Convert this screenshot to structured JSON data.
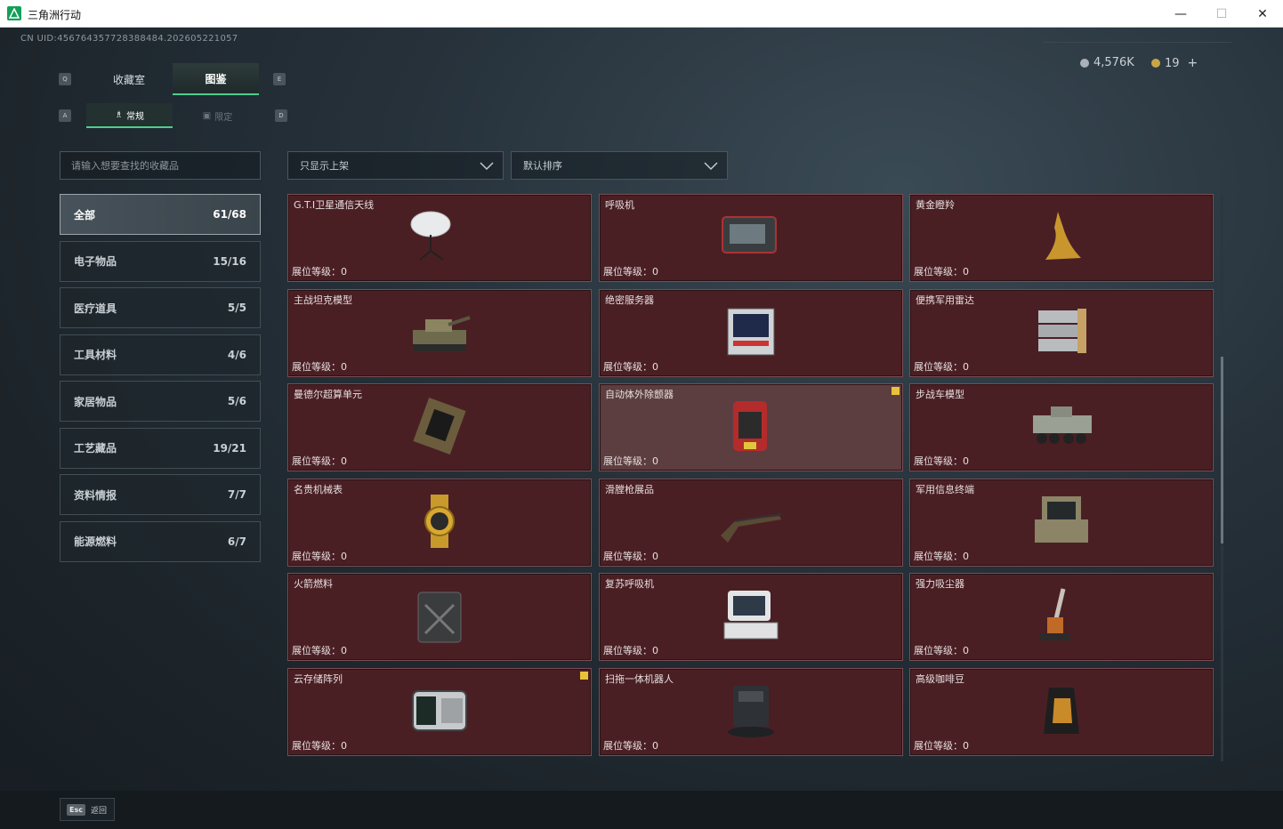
{
  "window": {
    "title": "三角洲行动",
    "min": "—",
    "max": "☐",
    "close": "✕"
  },
  "uid": "CN UID:456764357728388484.202605221057",
  "currency": {
    "silver": "4,576K",
    "gold": "19",
    "add": "+"
  },
  "keys": {
    "q": "Q",
    "e": "E",
    "a": "A",
    "d": "D"
  },
  "tabs": [
    {
      "label": "收藏室"
    },
    {
      "label": "图鉴"
    }
  ],
  "subtabs": [
    {
      "label": "常规"
    },
    {
      "label": "限定"
    }
  ],
  "search": {
    "placeholder": "请输入想要查找的收藏品"
  },
  "filters": {
    "shelf": "只显示上架",
    "sort": "默认排序"
  },
  "categories": [
    {
      "label": "全部",
      "count": "61/68"
    },
    {
      "label": "电子物品",
      "count": "15/16"
    },
    {
      "label": "医疗道具",
      "count": "5/5"
    },
    {
      "label": "工具材料",
      "count": "4/6"
    },
    {
      "label": "家居物品",
      "count": "5/6"
    },
    {
      "label": "工艺藏品",
      "count": "19/21"
    },
    {
      "label": "资料情报",
      "count": "7/7"
    },
    {
      "label": "能源燃料",
      "count": "6/7"
    }
  ],
  "items": [
    {
      "name": "G.T.I卫星通信天线",
      "level": "展位等级：0",
      "icon": "satellite-dish"
    },
    {
      "name": "呼吸机",
      "level": "展位等级：0",
      "icon": "ventilator"
    },
    {
      "name": "黄金瞪羚",
      "level": "展位等级：0",
      "icon": "gold-gazelle"
    },
    {
      "name": "主战坦克模型",
      "level": "展位等级：0",
      "icon": "tank-model"
    },
    {
      "name": "绝密服务器",
      "level": "展位等级：0",
      "icon": "server"
    },
    {
      "name": "便携军用雷达",
      "level": "展位等级：0",
      "icon": "radar"
    },
    {
      "name": "曼德尔超算单元",
      "level": "展位等级：0",
      "icon": "compute-unit"
    },
    {
      "name": "自动体外除颤器",
      "level": "展位等级：0",
      "icon": "defibrillator",
      "badge": true
    },
    {
      "name": "步战车模型",
      "level": "展位等级：0",
      "icon": "ifv-model"
    },
    {
      "name": "名贵机械表",
      "level": "展位等级：0",
      "icon": "watch"
    },
    {
      "name": "滑膛枪展品",
      "level": "展位等级：0",
      "icon": "musket"
    },
    {
      "name": "军用信息终端",
      "level": "展位等级：0",
      "icon": "info-terminal"
    },
    {
      "name": "火箭燃料",
      "level": "展位等级：0",
      "icon": "jerrycan"
    },
    {
      "name": "复苏呼吸机",
      "level": "展位等级：0",
      "icon": "resus-ventilator"
    },
    {
      "name": "强力吸尘器",
      "level": "展位等级：0",
      "icon": "vacuum"
    },
    {
      "name": "云存储阵列",
      "level": "展位等级：0",
      "icon": "storage-array",
      "badge": true
    },
    {
      "name": "扫拖一体机器人",
      "level": "展位等级：0",
      "icon": "robot-vacuum"
    },
    {
      "name": "高级咖啡豆",
      "level": "展位等级：0",
      "icon": "coffee-bag"
    }
  ],
  "footer": {
    "key": "Esc",
    "label": "返回"
  }
}
